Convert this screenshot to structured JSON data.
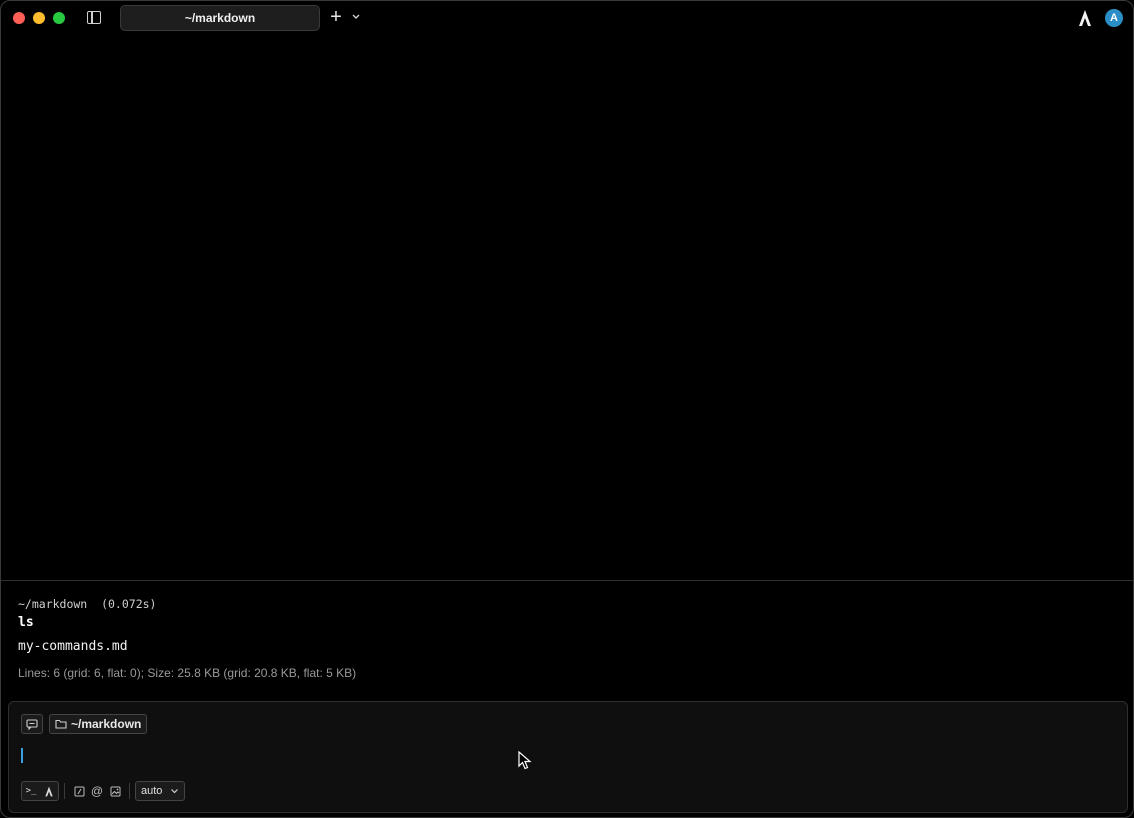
{
  "titlebar": {
    "tab_title": "~/markdown",
    "new_tab_label": "+",
    "avatar_initial": "A"
  },
  "block": {
    "header": "~/markdown  (0.072s)",
    "command": "ls",
    "output": "my-commands.md",
    "stats": "Lines: 6 (grid: 6, flat: 0); Size: 25.8 KB (grid: 20.8 KB, flat: 5 KB)"
  },
  "input": {
    "directory_chip": "~/markdown",
    "mode_terminal_label": ">_",
    "model_select": "auto"
  },
  "colors": {
    "accent": "#3aa0e0",
    "avatar_bg": "#2b8fc7",
    "close": "#ff5f57",
    "minimize": "#febc2e",
    "maximize": "#28c840"
  }
}
